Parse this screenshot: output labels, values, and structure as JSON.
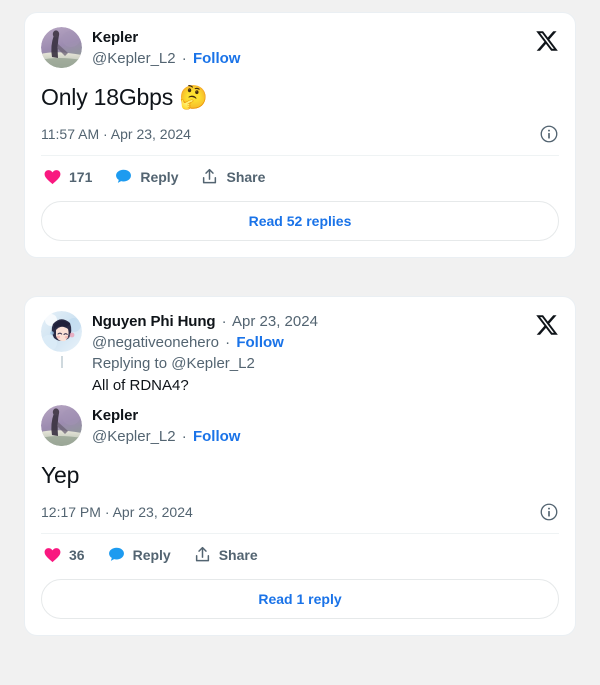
{
  "theme": {
    "page_bg": "#f1f1f1",
    "card_bg": "#ffffff",
    "text_primary": "#0f1419",
    "text_secondary": "#536471",
    "link_blue": "#1a73e8",
    "like_pink": "#f91880",
    "reply_blue": "#1d9bf0",
    "divider": "#eff3f4"
  },
  "cards": [
    {
      "brand_icon": "x-logo-icon",
      "author": {
        "avatar_icon": "avatar-kepler",
        "display_name": "Kepler",
        "handle": "@Kepler_L2",
        "separator": "·",
        "follow_label": "Follow"
      },
      "tweet_text": "Only 18Gbps",
      "tweet_emoji": "🤔",
      "timestamp": "11:57 AM · Apr 23, 2024",
      "info_icon": "info-circle-icon",
      "actions": {
        "like": {
          "icon": "heart-icon",
          "label": "171"
        },
        "reply": {
          "icon": "speech-bubble-icon",
          "label": "Reply"
        },
        "share": {
          "icon": "share-arrow-icon",
          "label": "Share"
        }
      },
      "read_replies_label": "Read 52 replies"
    },
    {
      "brand_icon": "x-logo-icon",
      "quoted": {
        "avatar_icon": "avatar-nguyen",
        "display_name": "Nguyen Phi Hung",
        "separator": "·",
        "date": "Apr 23, 2024",
        "handle": "@negativeonehero",
        "follow_label": "Follow",
        "replying_prefix": "Replying to ",
        "replying_to": "@Kepler_L2",
        "body": "All of RDNA4?"
      },
      "author": {
        "avatar_icon": "avatar-kepler",
        "display_name": "Kepler",
        "handle": "@Kepler_L2",
        "separator": "·",
        "follow_label": "Follow"
      },
      "tweet_text": "Yep",
      "tweet_emoji": "",
      "timestamp": "12:17 PM · Apr 23, 2024",
      "info_icon": "info-circle-icon",
      "actions": {
        "like": {
          "icon": "heart-icon",
          "label": "36"
        },
        "reply": {
          "icon": "speech-bubble-icon",
          "label": "Reply"
        },
        "share": {
          "icon": "share-arrow-icon",
          "label": "Share"
        }
      },
      "read_replies_label": "Read 1 reply"
    }
  ]
}
